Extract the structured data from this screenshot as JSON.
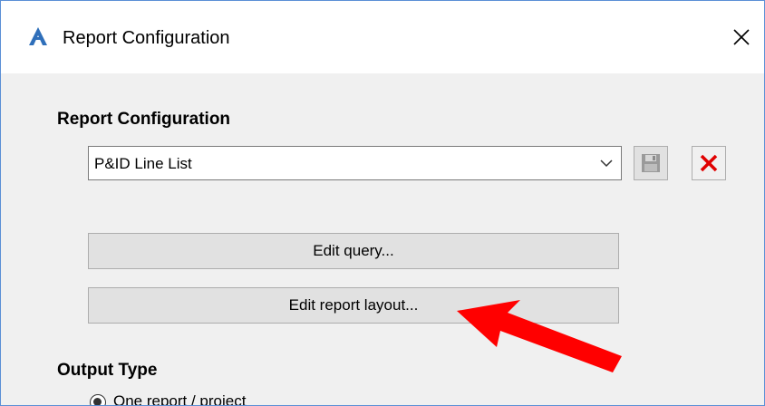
{
  "window": {
    "title": "Report Configuration",
    "app_icon": "autocad-plant-logo-icon",
    "close_icon": "close-icon"
  },
  "report_configuration": {
    "section_label": "Report Configuration",
    "selected_value": "P&ID Line List",
    "dropdown_icon": "chevron-down-icon",
    "save_icon": "save-disk-icon",
    "delete_icon": "red-x-delete-icon"
  },
  "buttons": {
    "edit_query": "Edit query...",
    "edit_report_layout": "Edit report layout..."
  },
  "output_type": {
    "section_label": "Output Type",
    "option_one_report": "One report / project"
  },
  "annotation": {
    "arrow_color": "#ff0000"
  }
}
